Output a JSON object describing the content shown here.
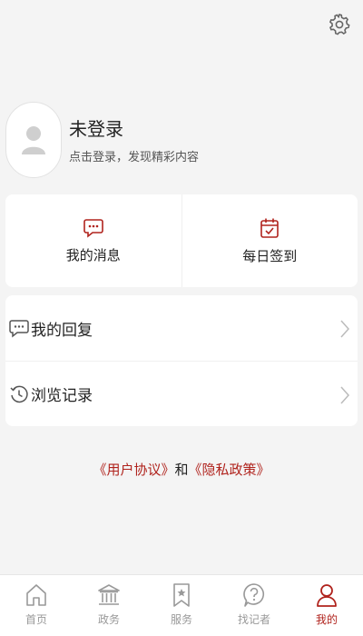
{
  "header": {
    "settings_icon": "gear-icon"
  },
  "profile": {
    "name": "未登录",
    "subtitle": "点击登录，发现精彩内容"
  },
  "quick": [
    {
      "label": "我的消息",
      "icon": "message-icon"
    },
    {
      "label": "每日签到",
      "icon": "calendar-check-icon"
    }
  ],
  "list": [
    {
      "label": "我的回复",
      "icon": "reply-icon"
    },
    {
      "label": "浏览记录",
      "icon": "history-icon"
    }
  ],
  "policy": {
    "user_agreement": "《用户协议》",
    "and": "和",
    "privacy_policy": "《隐私政策》"
  },
  "tabs": [
    {
      "label": "首页",
      "icon": "home-icon",
      "active": false
    },
    {
      "label": "政务",
      "icon": "government-icon",
      "active": false
    },
    {
      "label": "服务",
      "icon": "bookmark-star-icon",
      "active": false
    },
    {
      "label": "找记者",
      "icon": "question-bubble-icon",
      "active": false
    },
    {
      "label": "我的",
      "icon": "user-icon",
      "active": true
    }
  ],
  "colors": {
    "accent": "#b0231d",
    "inactive": "#999999",
    "background": "#f4f4f4"
  }
}
